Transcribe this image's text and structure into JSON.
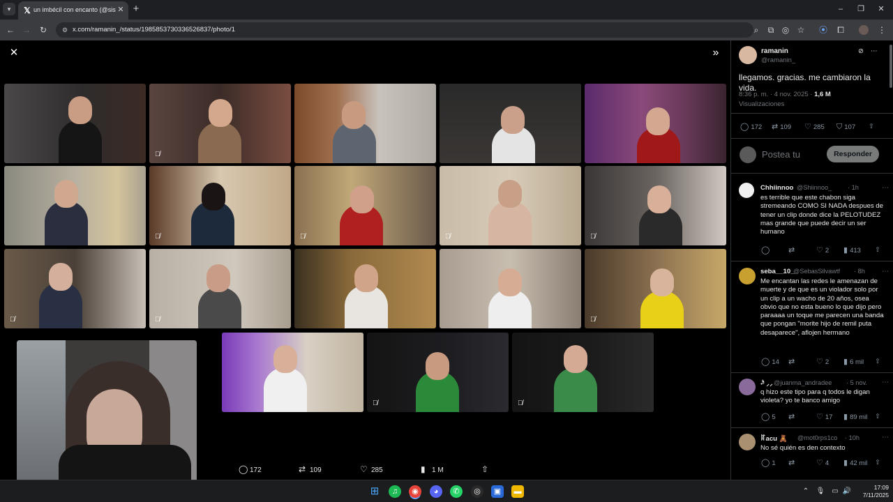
{
  "browser": {
    "tab_title": "un imbécil con encanto (@sistr",
    "url": "x.com/ramanin_/status/1985853730336526837/photo/1"
  },
  "post": {
    "display_name": "ramanin",
    "handle": "@ramanin_",
    "text": "llegamos. gracias. me cambiaron la vida.",
    "timestamp": "8:36 p. m. · 4 nov. 2025 ·",
    "views_count": "1,6 M",
    "views_label": "Visualizaciones",
    "stats": {
      "replies": "172",
      "reposts": "109",
      "likes": "285",
      "bookmarks": "107"
    }
  },
  "compose": {
    "placeholder": "Postea tu",
    "reply_button": "Responder"
  },
  "replies": [
    {
      "name": "Chhiinnoo",
      "handle": "@Shiinnoo_",
      "time": "· 1h",
      "text": "es terrible que este chabon siga stremeando COMO SI NADA despues de tener un clip donde dice la PELOTUDEZ mas grande que puede decir un ser humano",
      "replies": "",
      "reposts": "",
      "likes": "2",
      "views": "413"
    },
    {
      "name": "seba__10_",
      "handle": "@SebasSilvawtf",
      "time": "· 8h",
      "text": "Me encantan las redes le amenazan de muerte y de que es un violador solo por un clip a un wacho de 20 años, osea obvio que no esta bueno lo que dijo pero paraaaa un toque me parecen una banda que pongan \"morite hijo de remil puta desaparece\", aflojen hermano",
      "replies": "14",
      "reposts": "",
      "likes": "2",
      "views": "6 mil"
    },
    {
      "name": "𝆺𝅥𝅯 ⸝⸝",
      "handle": "@juanma_andradee",
      "time": "· 5 nov.",
      "text": "q hizo este tipo para q todos le digan violeta? yo te banco amigo",
      "replies": "5",
      "reposts": "",
      "likes": "17",
      "views": "89 mil"
    },
    {
      "name": "ꍏacu 🧸",
      "handle": "@mot0rps1co",
      "time": "· 10h",
      "text": "No sé quién es den contexto",
      "replies": "1",
      "reposts": "",
      "likes": "4",
      "views": "42 mil"
    }
  ],
  "media_bar": {
    "replies": "172",
    "reposts": "109",
    "likes": "285",
    "views": "1 M"
  },
  "clock": {
    "time": "17:09",
    "date": "7/11/2025"
  },
  "icons": {
    "close": "close-icon",
    "expand": "double-chevron-right-icon",
    "reply": "reply-icon",
    "repost": "repost-icon",
    "like": "heart-icon",
    "bookmark": "bookmark-icon",
    "share": "share-icon",
    "views": "bar-chart-icon",
    "grok": "grok-icon"
  },
  "colors": {
    "accent": "#1d9bf0",
    "active_speaker_border": "#4c9f5a",
    "background": "#000000"
  }
}
